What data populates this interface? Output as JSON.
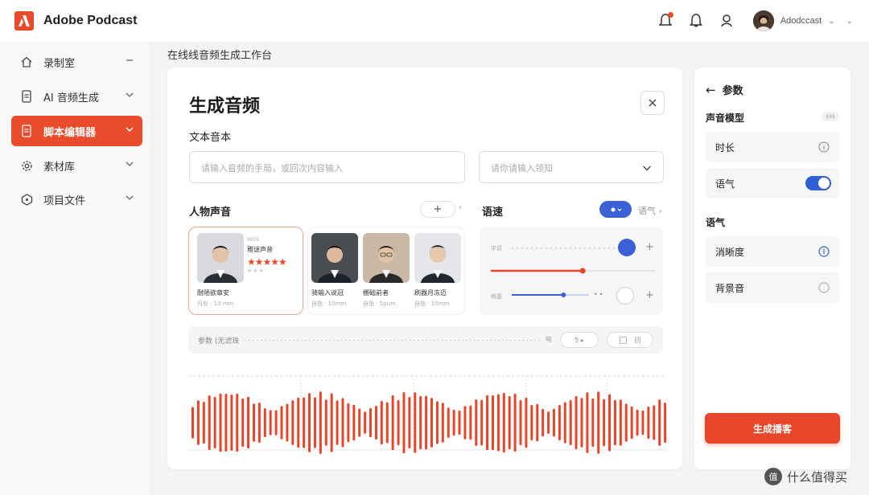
{
  "header": {
    "brand": "Adobe Podcast",
    "user_name": "Adodccast",
    "brand_color": "#eb4a2a"
  },
  "sidebar": {
    "items": [
      {
        "label": "录制室",
        "icon": "home-icon",
        "trailing": "minus"
      },
      {
        "label": "AI 音频生成",
        "icon": "document-icon",
        "trailing": "chevron-down"
      },
      {
        "label": "脚本编辑器",
        "icon": "script-icon",
        "trailing": "chevron-down",
        "active": true
      },
      {
        "label": "素材库",
        "icon": "gear-icon",
        "trailing": "chevron-down"
      },
      {
        "label": "项目文件",
        "icon": "project-icon",
        "trailing": "chevron-down"
      }
    ]
  },
  "breadcrumb": "在线线音频生成工作台",
  "main": {
    "title": "生成音频",
    "text_label": "文本音本",
    "text_placeholder": "请输入音频的手局，或回次内容输入",
    "select_placeholder": "请你请输入领知",
    "voice_label": "人物声音",
    "add_label": "+",
    "speed_label": "语速",
    "tone_link": "语气 ›",
    "persons": [
      {
        "name": "耐陋欲章安",
        "meta": "月份 · 10 mm",
        "tag": "REFS",
        "title": "雅谜声音",
        "rating": 5
      },
      {
        "name": "骑输入说冠",
        "meta": "自指 · 10mm"
      },
      {
        "name": "棚础前者",
        "meta": "自指 · 5pum"
      },
      {
        "name": "刷器月冻迈",
        "meta": "自指 · 10mm"
      }
    ],
    "speed_panel": {
      "row1_label": "宇说",
      "row2_label": "格基",
      "slider1_value": 0.56,
      "slider2_value": 0.67
    },
    "param_bar": {
      "text": "参数 (无滤珠",
      "end_label": "略",
      "pill1": "5 ▸",
      "pill2": "回"
    },
    "waveform": {
      "accent": "#e8462a"
    }
  },
  "panel": {
    "back_label": "参数",
    "model_label": "声音模型",
    "model_badge": "848",
    "rows": [
      {
        "label": "时长",
        "indicator": "info"
      },
      {
        "label": "语气",
        "indicator": "toggle-on"
      }
    ],
    "tone_section": "语气",
    "tone_rows": [
      {
        "label": "消晰度",
        "indicator": "radio-selected"
      },
      {
        "label": "背景音",
        "indicator": "radio"
      }
    ],
    "generate_label": "生成播客"
  },
  "watermark": {
    "text": "什么值得买",
    "icon_text": "值"
  }
}
